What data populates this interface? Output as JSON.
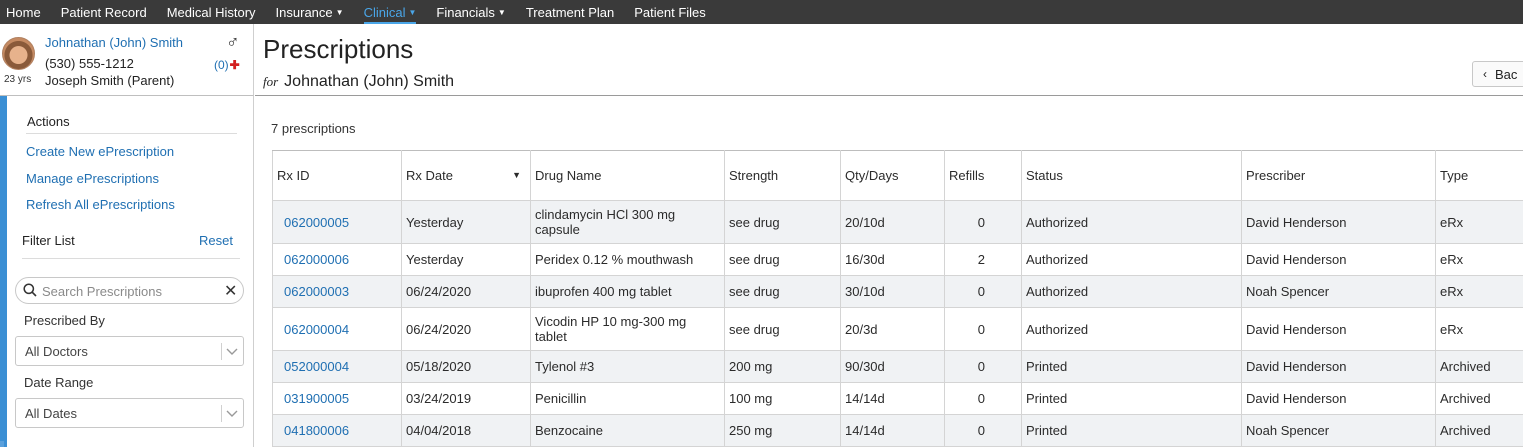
{
  "nav": {
    "items": [
      {
        "label": "Home",
        "dropdown": false,
        "active": false
      },
      {
        "label": "Patient Record",
        "dropdown": false,
        "active": false
      },
      {
        "label": "Medical History",
        "dropdown": false,
        "active": false
      },
      {
        "label": "Insurance",
        "dropdown": true,
        "active": false
      },
      {
        "label": "Clinical",
        "dropdown": true,
        "active": true
      },
      {
        "label": "Financials",
        "dropdown": true,
        "active": false
      },
      {
        "label": "Treatment Plan",
        "dropdown": false,
        "active": false
      },
      {
        "label": "Patient Files",
        "dropdown": false,
        "active": false
      }
    ]
  },
  "patient": {
    "name": "Johnathan (John) Smith",
    "phone": "(530) 555-1212",
    "parent": "Joseph Smith (Parent)",
    "age": "23 yrs",
    "gender_icon": "♂",
    "alert_count": "(0)",
    "alert_plus": "✚"
  },
  "sidebar": {
    "actions_title": "Actions",
    "actions": [
      {
        "label": "Create New ePrescription"
      },
      {
        "label": "Manage ePrescriptions"
      },
      {
        "label": "Refresh All ePrescriptions"
      }
    ],
    "filter_title": "Filter List",
    "reset_label": "Reset",
    "search_placeholder": "Search Prescriptions",
    "clear_icon": "✕",
    "prescribed_by_label": "Prescribed By",
    "prescribed_by_value": "All Doctors",
    "date_range_label": "Date Range",
    "date_range_value": "All Dates"
  },
  "main": {
    "title": "Prescriptions",
    "subtitle_for": "for",
    "subtitle_name": "Johnathan (John) Smith",
    "back_label": "Bac",
    "count_text": "7 prescriptions"
  },
  "table": {
    "columns": [
      "Rx ID",
      "Rx Date",
      "Drug Name",
      "Strength",
      "Qty/Days",
      "Refills",
      "Status",
      "Prescriber",
      "Type"
    ],
    "sort_column": "Rx Date",
    "rows": [
      {
        "rx_id": "062000005",
        "date": "Yesterday",
        "drug": "clindamycin HCl 300 mg capsule",
        "strength": "see drug",
        "qty": "20/10d",
        "refills": "0",
        "status": "Authorized",
        "prescriber": "David Henderson",
        "type": "eRx"
      },
      {
        "rx_id": "062000006",
        "date": "Yesterday",
        "drug": "Peridex 0.12 % mouthwash",
        "strength": "see drug",
        "qty": "16/30d",
        "refills": "2",
        "status": "Authorized",
        "prescriber": "David Henderson",
        "type": "eRx"
      },
      {
        "rx_id": "062000003",
        "date": "06/24/2020",
        "drug": "ibuprofen 400 mg tablet",
        "strength": "see drug",
        "qty": "30/10d",
        "refills": "0",
        "status": "Authorized",
        "prescriber": "Noah Spencer",
        "type": "eRx"
      },
      {
        "rx_id": "062000004",
        "date": "06/24/2020",
        "drug": "Vicodin HP 10 mg-300 mg tablet",
        "strength": "see drug",
        "qty": "20/3d",
        "refills": "0",
        "status": "Authorized",
        "prescriber": "David Henderson",
        "type": "eRx"
      },
      {
        "rx_id": "052000004",
        "date": "05/18/2020",
        "drug": "Tylenol #3",
        "strength": "200 mg",
        "qty": "90/30d",
        "refills": "0",
        "status": "Printed",
        "prescriber": "David Henderson",
        "type": "Archived"
      },
      {
        "rx_id": "031900005",
        "date": "03/24/2019",
        "drug": "Penicillin",
        "strength": "100 mg",
        "qty": "14/14d",
        "refills": "0",
        "status": "Printed",
        "prescriber": "David Henderson",
        "type": "Archived"
      },
      {
        "rx_id": "041800006",
        "date": "04/04/2018",
        "drug": "Benzocaine",
        "strength": "250 mg",
        "qty": "14/14d",
        "refills": "0",
        "status": "Printed",
        "prescriber": "Noah Spencer",
        "type": "Archived"
      }
    ]
  }
}
